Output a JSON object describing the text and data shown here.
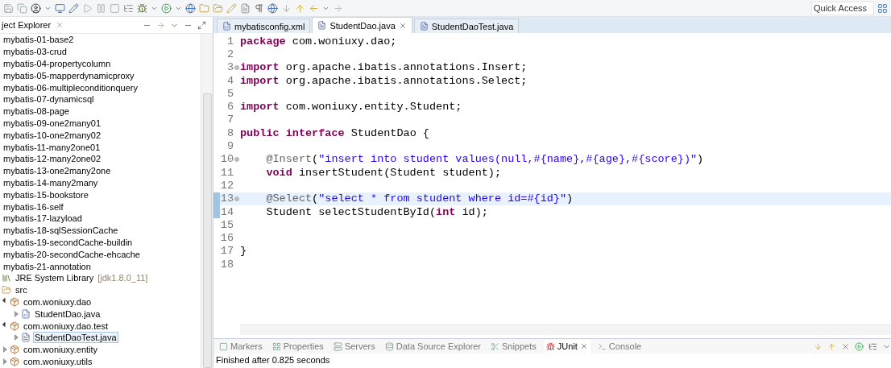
{
  "explorer": {
    "title": "ject Explorer",
    "tree": [
      {
        "kind": "project",
        "label": "mybatis-01-base2"
      },
      {
        "kind": "project",
        "label": "mybatis-03-crud"
      },
      {
        "kind": "project",
        "label": "mybatis-04-propertycolumn"
      },
      {
        "kind": "project",
        "label": "mybatis-05-mapperdynamicproxy"
      },
      {
        "kind": "project",
        "label": "mybatis-06-multipleconditionquery"
      },
      {
        "kind": "project",
        "label": "mybatis-07-dynamicsql"
      },
      {
        "kind": "project",
        "label": "mybatis-08-page"
      },
      {
        "kind": "project",
        "label": "mybatis-09-one2many01"
      },
      {
        "kind": "project",
        "label": "mybatis-10-one2many02"
      },
      {
        "kind": "project",
        "label": "mybatis-11-many2one01"
      },
      {
        "kind": "project",
        "label": "mybatis-12-many2one02"
      },
      {
        "kind": "project",
        "label": "mybatis-13-one2many2one"
      },
      {
        "kind": "project",
        "label": "mybatis-14-many2many"
      },
      {
        "kind": "project",
        "label": "mybatis-15-bookstore"
      },
      {
        "kind": "project",
        "label": "mybatis-16-self"
      },
      {
        "kind": "project",
        "label": "mybatis-17-lazyload"
      },
      {
        "kind": "project",
        "label": "mybatis-18-sqlSessionCache"
      },
      {
        "kind": "project",
        "label": "mybatis-19-secondCache-buildin"
      },
      {
        "kind": "project",
        "label": "mybatis-20-secondCache-ehcache"
      },
      {
        "kind": "project",
        "label": "mybatis-21-annotation"
      },
      {
        "kind": "library",
        "label": "JRE System Library",
        "detail": "[jdk1.8.0_11]"
      },
      {
        "kind": "folder",
        "label": "src",
        "children": [
          {
            "kind": "package",
            "label": "com.woniuxy.dao",
            "expanded": true,
            "selected": false,
            "children": [
              {
                "kind": "interface",
                "label": "StudentDao.java",
                "expanded": false,
                "selected": false
              }
            ]
          },
          {
            "kind": "package",
            "label": "com.woniuxy.dao.test",
            "expanded": true,
            "selected": false,
            "children": [
              {
                "kind": "class",
                "label": "StudentDaoTest.java",
                "expanded": false,
                "selected": true
              }
            ]
          },
          {
            "kind": "package",
            "label": "com.woniuxy.entity",
            "expanded": false,
            "selected": false
          },
          {
            "kind": "package",
            "label": "com.woniuxy.utils",
            "expanded": false,
            "selected": false
          }
        ]
      }
    ]
  },
  "quick_access": {
    "placeholder": "Quick Access"
  },
  "editor": {
    "tabs": [
      {
        "label": "mybatisconfig.xml",
        "kind": "xml",
        "selected": false
      },
      {
        "label": "StudentDao.java",
        "kind": "java",
        "selected": true
      },
      {
        "label": "StudentDaoTest.java",
        "kind": "java",
        "selected": false
      }
    ],
    "lines": [
      {
        "number": "1",
        "fold": false,
        "current": false,
        "changed": false,
        "indented": false,
        "tokens": [
          {
            "kind": "keyword",
            "text": "package"
          },
          {
            "kind": "plain",
            "text": " com.woniuxy.dao;"
          }
        ]
      },
      {
        "number": "2",
        "fold": false,
        "current": false,
        "changed": false
      },
      {
        "number": "3",
        "fold": true,
        "current": false,
        "changed": false,
        "indented": false,
        "tokens": [
          {
            "kind": "keyword",
            "text": "import"
          },
          {
            "kind": "plain",
            "text": " org.apache.ibatis.annotations.Insert;"
          }
        ]
      },
      {
        "number": "4",
        "fold": false,
        "current": false,
        "changed": false,
        "indented": false,
        "tokens": [
          {
            "kind": "keyword",
            "text": "import"
          },
          {
            "kind": "plain",
            "text": " org.apache.ibatis.annotations.Select;"
          }
        ]
      },
      {
        "number": "5",
        "fold": false,
        "current": false,
        "changed": false
      },
      {
        "number": "6",
        "fold": false,
        "current": false,
        "changed": false,
        "indented": false,
        "tokens": [
          {
            "kind": "keyword",
            "text": "import"
          },
          {
            "kind": "plain",
            "text": " com.woniuxy.entity.Student;"
          }
        ]
      },
      {
        "number": "7",
        "fold": false,
        "current": false,
        "changed": false
      },
      {
        "number": "8",
        "fold": false,
        "current": false,
        "changed": false,
        "indented": false,
        "tokens": [
          {
            "kind": "keyword",
            "text": "public"
          },
          {
            "kind": "keyword",
            "text": " interface"
          },
          {
            "kind": "plain",
            "text": " StudentDao {"
          }
        ]
      },
      {
        "number": "9",
        "fold": false,
        "current": false,
        "changed": false
      },
      {
        "number": "10",
        "fold": true,
        "current": false,
        "changed": false,
        "indented": true,
        "tokens": [
          {
            "kind": "annotation",
            "text": "@Insert"
          },
          {
            "kind": "plain",
            "text": "("
          },
          {
            "kind": "string",
            "text": "\"insert into student values(null,#{name},#{age},#{score})\""
          },
          {
            "kind": "plain",
            "text": ")"
          }
        ]
      },
      {
        "number": "11",
        "fold": false,
        "current": false,
        "changed": false,
        "indented": true,
        "tokens": [
          {
            "kind": "keyword",
            "text": "void"
          },
          {
            "kind": "plain",
            "text": " insertStudent(Student student);"
          }
        ]
      },
      {
        "number": "12",
        "fold": false,
        "current": false,
        "changed": false
      },
      {
        "number": "13",
        "fold": true,
        "current": true,
        "changed": true,
        "indented": true,
        "tokens": [
          {
            "kind": "annotation",
            "text": "@Select"
          },
          {
            "kind": "plain",
            "text": "("
          },
          {
            "kind": "string",
            "text": "\"select * from student where id=#{id}\""
          },
          {
            "kind": "plain",
            "text": ")"
          }
        ]
      },
      {
        "number": "14",
        "fold": false,
        "current": false,
        "changed": true,
        "indented": true,
        "tokens": [
          {
            "kind": "plain",
            "text": "Student selectStudentById("
          },
          {
            "kind": "keyword",
            "text": "int"
          },
          {
            "kind": "plain",
            "text": " id);"
          }
        ]
      },
      {
        "number": "15",
        "fold": false,
        "current": false,
        "changed": false
      },
      {
        "number": "16",
        "fold": false,
        "current": false,
        "changed": false
      },
      {
        "number": "17",
        "fold": false,
        "current": false,
        "changed": false,
        "indented": false,
        "tokens": [
          {
            "kind": "plain",
            "text": "}"
          }
        ]
      },
      {
        "number": "18",
        "fold": false,
        "current": false,
        "changed": false
      }
    ]
  },
  "bottom_panel": {
    "tabs": [
      {
        "label": "Markers",
        "selected": false
      },
      {
        "label": "Properties",
        "selected": false
      },
      {
        "label": "Servers",
        "selected": false
      },
      {
        "label": "Data Source Explorer",
        "selected": false
      },
      {
        "label": "Snippets",
        "selected": false
      },
      {
        "label": "JUnit",
        "selected": true
      },
      {
        "label": "Console",
        "selected": false
      }
    ],
    "status": "Finished after 0.825 seconds"
  }
}
